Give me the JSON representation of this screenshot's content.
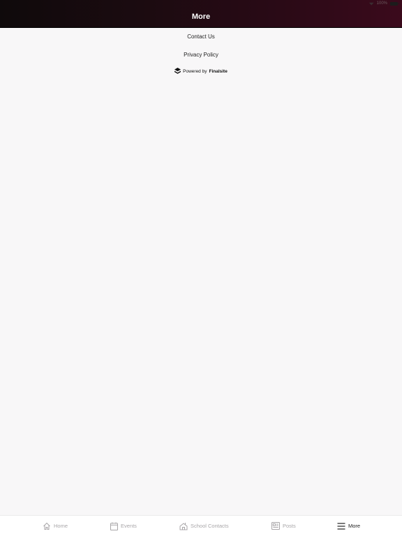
{
  "status_bar": {
    "time_text": "100%"
  },
  "nav_bar": {
    "title": "More"
  },
  "menu": {
    "items": [
      {
        "label": "Contact Us"
      },
      {
        "label": "Privacy Policy"
      }
    ]
  },
  "footer": {
    "powered_prefix": "Powered by",
    "powered_brand": "Finalsite"
  },
  "tab_bar": {
    "tabs": [
      {
        "label": "Home",
        "icon": "home-icon",
        "active": false
      },
      {
        "label": "Events",
        "icon": "calendar-icon",
        "active": false
      },
      {
        "label": "School Contacts",
        "icon": "directory-icon",
        "active": false
      },
      {
        "label": "Posts",
        "icon": "news-icon",
        "active": false
      },
      {
        "label": "More",
        "icon": "hamburger-menu-icon",
        "active": true
      }
    ]
  },
  "colors": {
    "accent": "#3b0a1c",
    "background": "#f8f7f8",
    "active_tab": "#222222",
    "inactive_tab": "#a8a6a8"
  }
}
